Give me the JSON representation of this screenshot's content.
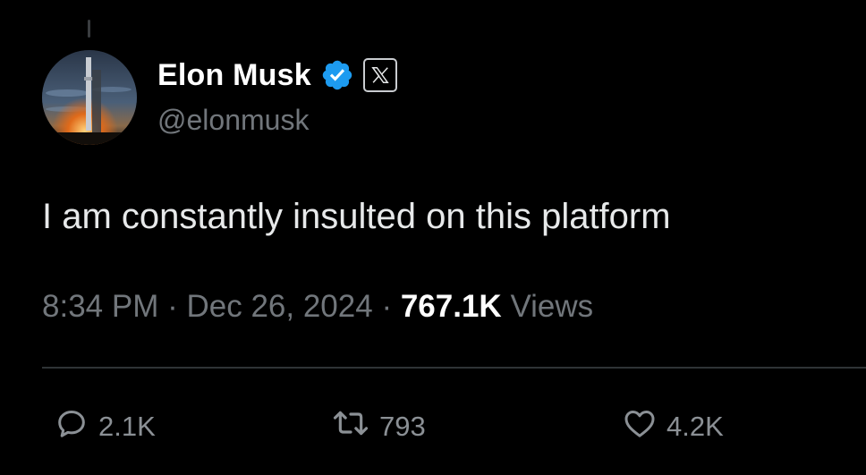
{
  "author": {
    "display_name": "Elon Musk",
    "handle": "@elonmusk",
    "verified": true,
    "verified_color": "#1d9bf0",
    "badge_icon": "x-logo-icon"
  },
  "tweet": {
    "text": "I am constantly insulted on this platform",
    "time": "8:34 PM",
    "separator": "·",
    "date": "Dec 26, 2024",
    "views_count": "767.1K",
    "views_label": "Views"
  },
  "actions": {
    "reply": {
      "icon": "reply-icon",
      "count": "2.1K"
    },
    "retweet": {
      "icon": "retweet-icon",
      "count": "793"
    },
    "like": {
      "icon": "heart-icon",
      "count": "4.2K"
    }
  },
  "colors": {
    "background": "#000000",
    "primary_text": "#e7e9ea",
    "secondary_text": "#71767b",
    "divider": "#2f3336"
  }
}
